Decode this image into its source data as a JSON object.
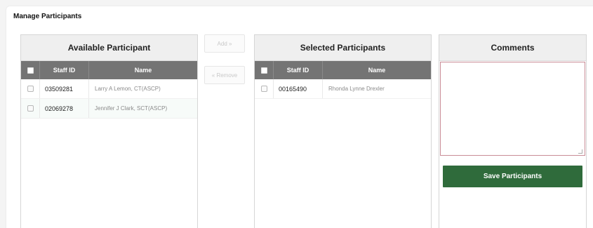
{
  "page": {
    "title": "Manage Participants"
  },
  "available": {
    "header": "Available Participant",
    "columns": {
      "id": "Staff ID",
      "name": "Name"
    },
    "rows": [
      {
        "id": "03509281",
        "name": "Larry A Lemon, CT(ASCP)"
      },
      {
        "id": "02069278",
        "name": "Jennifer J Clark, SCT(ASCP)"
      }
    ]
  },
  "actions": {
    "add_label": "Add »",
    "remove_label": "« Remove"
  },
  "selected": {
    "header": "Selected Participants",
    "columns": {
      "id": "Staff ID",
      "name": "Name"
    },
    "rows": [
      {
        "id": "00165490",
        "name": "Rhonda Lynne Drexler"
      }
    ]
  },
  "comments": {
    "header": "Comments",
    "value": "",
    "save_label": "Save Participants"
  },
  "colors": {
    "header_bg": "#747474",
    "save_btn": "#2f6b3b",
    "comment_border": "#c98c96"
  }
}
